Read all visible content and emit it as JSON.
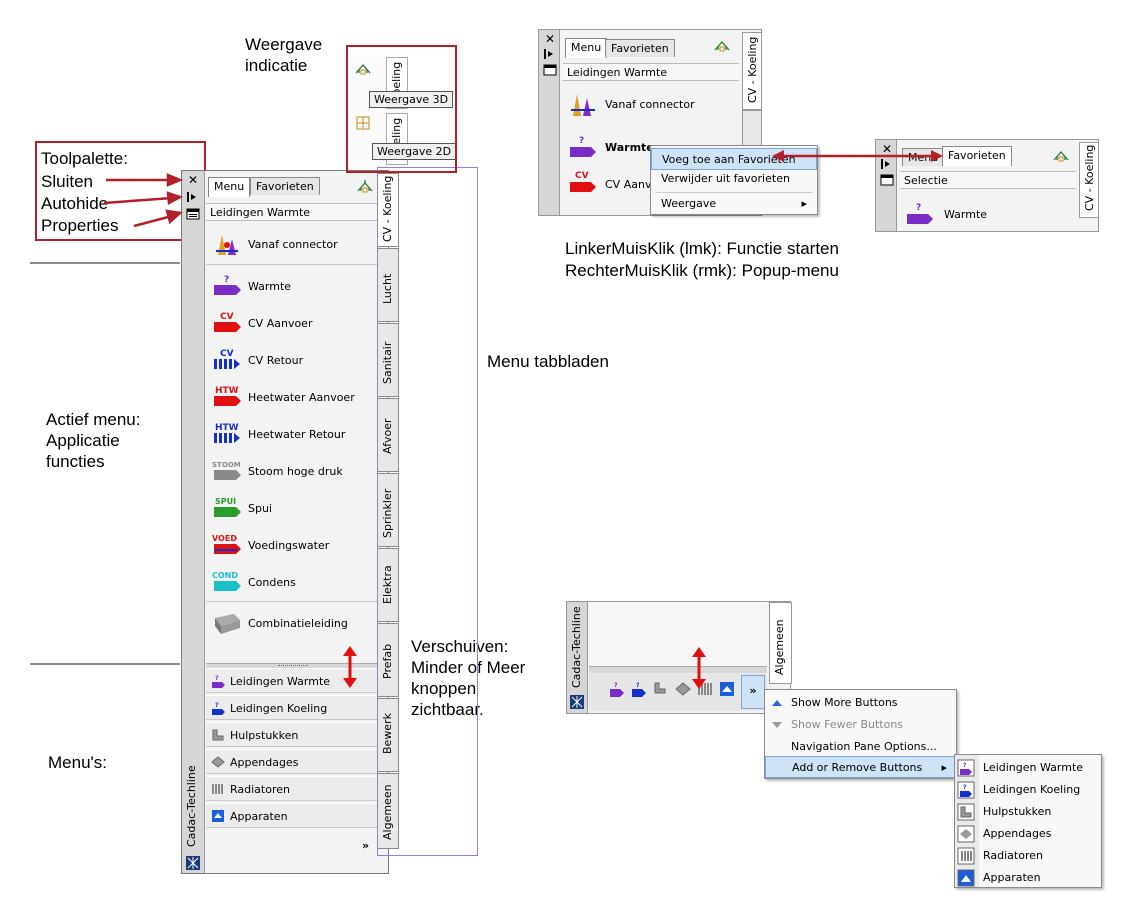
{
  "annotations": {
    "weergave_title": "Weergave\nindicatie",
    "toolpalette": "Toolpalette:",
    "sluiten": "Sluiten",
    "autohide": "Autohide",
    "properties": "Properties",
    "actief_menu": "Actief menu:\nApplicatie\nfuncties",
    "menus": "Menu's:",
    "menu_tabbladen": "Menu tabbladen",
    "verschuiven": "Verschuiven:\nMinder of Meer\nknoppen\nzichtbaar.",
    "lmk": "LinkerMuisKlik (lmk): Functie starten",
    "rmk": "RechterMuisKlik (rmk): Popup-menu"
  },
  "palette": {
    "title": "Cadac-Techline",
    "tabs": [
      "Menu",
      "Favorieten"
    ],
    "section_header": "Leidingen Warmte",
    "items": [
      {
        "label": "Vanaf connector",
        "icon": "connector-icon"
      },
      {
        "label": "Warmte",
        "icon": "warmte-pipe-icon",
        "tag": "?"
      },
      {
        "label": "CV Aanvoer",
        "icon": "cv-aanvoer-icon",
        "tag": "CV"
      },
      {
        "label": "CV Retour",
        "icon": "cv-retour-icon",
        "tag": "CV"
      },
      {
        "label": "Heetwater Aanvoer",
        "icon": "htw-aanvoer-icon",
        "tag": "HTW"
      },
      {
        "label": "Heetwater Retour",
        "icon": "htw-retour-icon",
        "tag": "HTW"
      },
      {
        "label": "Stoom hoge druk",
        "icon": "stoom-icon",
        "tag": "STOOM"
      },
      {
        "label": "Spui",
        "icon": "spui-icon",
        "tag": "SPUI"
      },
      {
        "label": "Voedingswater",
        "icon": "voed-icon",
        "tag": "VOED"
      },
      {
        "label": "Condens",
        "icon": "cond-icon",
        "tag": "COND"
      },
      {
        "label": "Combinatieleiding",
        "icon": "combinatie-icon"
      }
    ],
    "side_tabs": [
      "CV - Koeling",
      "Lucht",
      "Sanitair",
      "Afvoer",
      "Sprinkler",
      "Elektra",
      "Prefab",
      "Bewerk",
      "Algemeen"
    ],
    "menu_buttons": [
      {
        "label": "Leidingen Warmte",
        "icon": "leidingen-warmte-icon"
      },
      {
        "label": "Leidingen Koeling",
        "icon": "leidingen-koeling-icon"
      },
      {
        "label": "Hulpstukken",
        "icon": "hulpstukken-icon"
      },
      {
        "label": "Appendages",
        "icon": "appendages-icon"
      },
      {
        "label": "Radiatoren",
        "icon": "radiatoren-icon"
      },
      {
        "label": "Apparaten",
        "icon": "apparaten-icon"
      }
    ],
    "overflow": "»"
  },
  "weergave": {
    "tab_label": "Koeling",
    "tooltip_3d": "Weergave 3D",
    "tooltip_2d": "Weergave 2D"
  },
  "context_shot": {
    "tabs": [
      "Menu",
      "Favorieten"
    ],
    "side_tab": "CV - Koeling",
    "side_tab_2": "cht",
    "section_header": "Leidingen Warmte",
    "items": [
      "Vanaf connector",
      "Warmte",
      "CV Aanvoe"
    ],
    "menu": [
      "Voeg toe aan Favorieten",
      "Verwijder uit favorieten",
      "Weergave"
    ],
    "submenu_arrow": "▸"
  },
  "fav_shot": {
    "tabs": [
      "Menu",
      "Favorieten"
    ],
    "side_tab": "CV - Koeling",
    "section_header": "Selectie",
    "item": "Warmte"
  },
  "nav_shot": {
    "title": "Cadac-Techline",
    "side_tab": "Algemeen",
    "overflow": "»",
    "menu": [
      "Show More Buttons",
      "Show Fewer Buttons",
      "Navigation Pane Options...",
      "Add or Remove Buttons"
    ],
    "submenu": [
      "Leidingen Warmte",
      "Leidingen Koeling",
      "Hulpstukken",
      "Appendages",
      "Radiatoren",
      "Apparaten"
    ]
  },
  "colors": {
    "annotation_red": "#b3202a",
    "purple": "#7a2cc4",
    "red": "#e01010",
    "blue": "#1530c8",
    "green": "#2a9a2a",
    "gray": "#8a8a8a",
    "cyan": "#1abfc6",
    "highlight": "#cfe3f7"
  }
}
